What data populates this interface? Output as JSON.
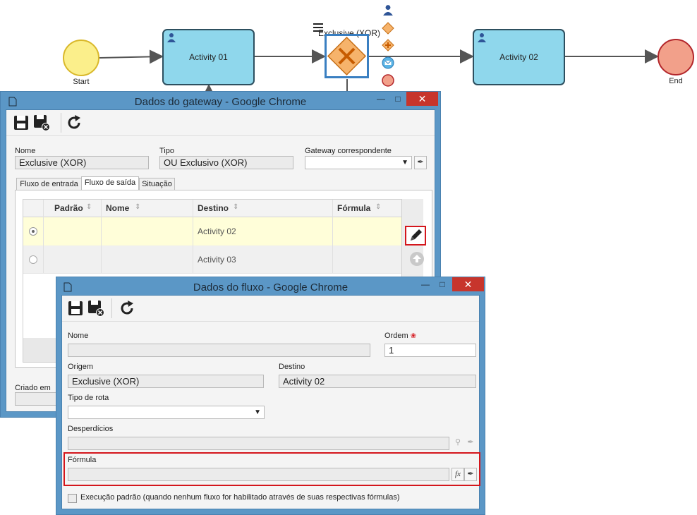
{
  "diagram": {
    "start_label": "Start",
    "end_label": "End",
    "activity1": "Activity 01",
    "activity2": "Activity 02",
    "gateway_label": "Exclusive (XOR)"
  },
  "gateway_window": {
    "title": "Dados do gateway - Google Chrome",
    "name_label": "Nome",
    "name_value": "Exclusive (XOR)",
    "type_label": "Tipo",
    "type_value": "OU Exclusivo (XOR)",
    "corr_label": "Gateway correspondente",
    "corr_value": "",
    "tabs": [
      "Fluxo de entrada",
      "Fluxo de saída",
      "Situação"
    ],
    "columns": [
      "Padrão",
      "Nome",
      "Destino",
      "Fórmula"
    ],
    "rows": [
      {
        "nome": "",
        "destino": "Activity 02",
        "formula": ""
      },
      {
        "nome": "",
        "destino": "Activity 03",
        "formula": ""
      }
    ],
    "created_label": "Criado em"
  },
  "flow_window": {
    "title": "Dados do fluxo - Google Chrome",
    "name_label": "Nome",
    "name_value": "",
    "order_label": "Ordem",
    "order_value": "1",
    "origin_label": "Origem",
    "origin_value": "Exclusive (XOR)",
    "dest_label": "Destino",
    "dest_value": "Activity 02",
    "route_label": "Tipo de rota",
    "route_value": "",
    "waste_label": "Desperdícios",
    "waste_value": "",
    "formula_label": "Fórmula",
    "formula_value": "",
    "formula_btn": "fx",
    "default_exec_label": "Execução padrão (quando nenhum fluxo for habilitado através de suas respectivas fórmulas)"
  },
  "colors": {
    "window_frame": "#5b97c6",
    "close_red": "#c7352c",
    "highlight_red": "#d4161c",
    "task_fill": "#8fd7ec",
    "start_fill": "#fbef8b",
    "end_fill": "#f2a08a",
    "gateway_fill": "#f6b36b",
    "selected_row": "#fffed9"
  }
}
